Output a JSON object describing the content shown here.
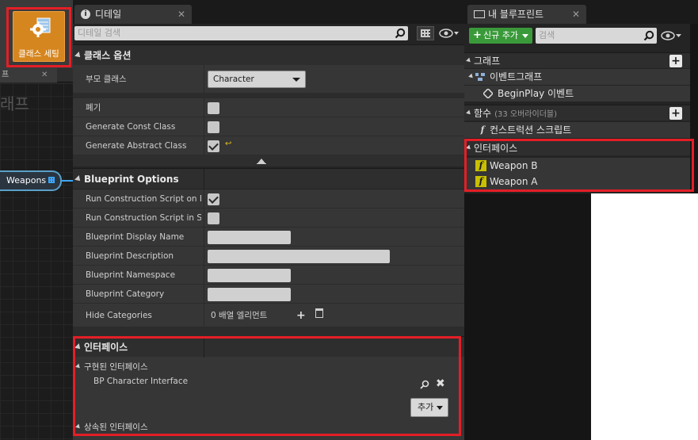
{
  "toolbar": {
    "class_settings_label": "클래스 세팅"
  },
  "graph": {
    "tab_label": "프",
    "tab_close": "✕",
    "title": "래프",
    "node_label": "Weapons"
  },
  "details": {
    "tab_label": "디테일",
    "tab_close": "✕",
    "search_placeholder": "디테일 검색",
    "class_options": {
      "header": "클래스 옵션",
      "parent_class_label": "부모 클래스",
      "parent_class_value": "Character",
      "rows": [
        {
          "label": "폐기",
          "checked": false
        },
        {
          "label": "Generate Const Class",
          "checked": false
        },
        {
          "label": "Generate Abstract Class",
          "checked": true
        }
      ]
    },
    "blueprint_options": {
      "header": "Blueprint Options",
      "rows": [
        {
          "label": "Run Construction Script on Dra",
          "kind": "checkbox",
          "checked": true
        },
        {
          "label": "Run Construction Script in Seq",
          "kind": "checkbox",
          "checked": false
        },
        {
          "label": "Blueprint Display Name",
          "kind": "text"
        },
        {
          "label": "Blueprint Description",
          "kind": "text"
        },
        {
          "label": "Blueprint Namespace",
          "kind": "text"
        },
        {
          "label": "Blueprint Category",
          "kind": "text"
        },
        {
          "label": "Hide Categories",
          "kind": "array",
          "value": "0 배열 엘리먼트"
        }
      ]
    },
    "interfaces": {
      "header": "인터페이스",
      "implemented_header": "구현된 인터페이스",
      "implemented_items": [
        "BP Character Interface"
      ],
      "add_button": "추가",
      "inherited_header": "상속된 인터페이스"
    }
  },
  "my_blueprint": {
    "tab_label": "내 블루프린트",
    "tab_close": "✕",
    "new_add_button": "신규 추가",
    "search_placeholder": "검색",
    "graph_section": "그래프",
    "event_graph": "이벤트그래프",
    "begin_play": "BeginPlay 이벤트",
    "functions_section": "함수",
    "functions_note": "(33 오버라이더블)",
    "construction_script": "컨스트럭션 스크립트",
    "interfaces_section": "인터페이스",
    "interface_functions": [
      "Weapon B",
      "Weapon A"
    ]
  },
  "colors": {
    "highlight": "#e41e26",
    "class_settings_bg": "#d6861f",
    "new_add_green": "#3a9a3a",
    "function_icon": "#c8c000",
    "wire_blue": "#3aa7ff"
  }
}
